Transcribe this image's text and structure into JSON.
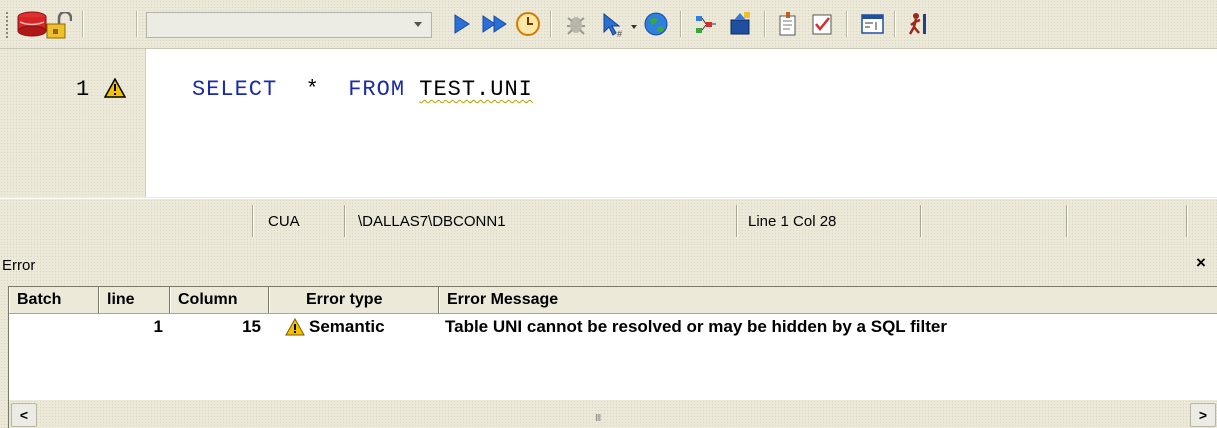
{
  "toolbar": {
    "connection_select": {
      "value": ""
    },
    "icons": [
      "database-icon",
      "lock-icon",
      "run-icon",
      "run-all-icon",
      "schedule-icon",
      "debug-icon",
      "step-into-icon",
      "globe-icon",
      "explain-icon",
      "visual-explain-icon",
      "format-icon",
      "check-syntax-icon",
      "results-icon",
      "stop-icon"
    ]
  },
  "editor": {
    "line_number": "1",
    "code": {
      "select_kw": "SELECT",
      "star": "*",
      "from_kw": "FROM",
      "table": "TEST.UNI"
    }
  },
  "statusbar": {
    "mode": "CUA",
    "connection": "\\DALLAS7\\DBCONN1",
    "position": "Line 1 Col 28"
  },
  "error_panel": {
    "title": "Error",
    "close": "×",
    "columns": [
      "Batch",
      "line",
      "Column",
      "Error type",
      "Error Message"
    ],
    "rows": [
      {
        "batch": "",
        "line": "1",
        "column": "15",
        "error_type": "Semantic",
        "message": "Table UNI  cannot be resolved or may be hidden by a SQL filter"
      }
    ],
    "scroll": {
      "left": "<",
      "right": ">",
      "grip": "III"
    }
  },
  "colors": {
    "background": "#ece9d8",
    "keyword": "#1a2aa8",
    "warning": "#f2c200",
    "run": "#2a6fd8"
  }
}
